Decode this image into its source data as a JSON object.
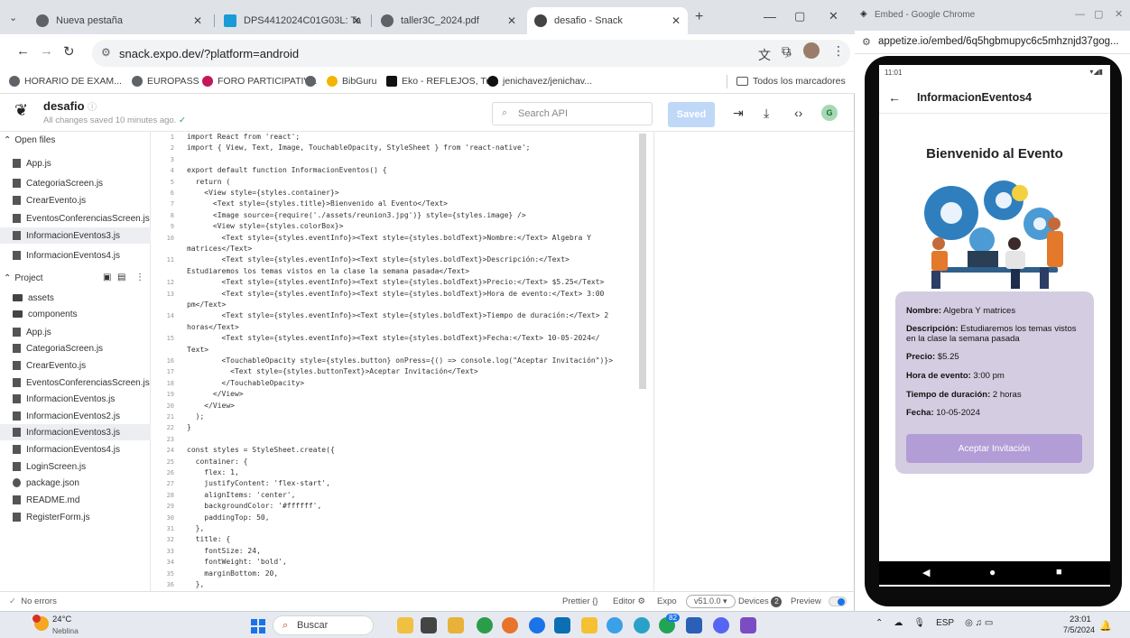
{
  "browser": {
    "tabs": [
      {
        "label": "Nueva pestaña"
      },
      {
        "label": "DPS4412024C01G03L: Taller"
      },
      {
        "label": "taller3C_2024.pdf"
      },
      {
        "label": "desafio - Snack"
      }
    ],
    "url": "snack.expo.dev/?platform=android",
    "bookmarks": [
      "HORARIO DE EXAM...",
      "EUROPASS",
      "FORO PARTICIPATIV...",
      "BibGuru",
      "Eko - REFLEJOS, Tu...",
      "jenichavez/jenichav..."
    ],
    "all_bookmarks": "Todos los marcadores"
  },
  "snack": {
    "project_name": "desafio",
    "status": "All changes saved 10 minutes ago.",
    "search_placeholder": "Search API",
    "saved_label": "Saved",
    "avatar_initial": "G",
    "open_files_label": "Open files",
    "open_files": [
      "App.js",
      "CategoriaScreen.js",
      "CrearEvento.js",
      "EventosConferenciasScreen.js",
      "InformacionEventos3.js",
      "InformacionEventos4.js"
    ],
    "project_label": "Project",
    "project_files": [
      "assets",
      "components",
      "App.js",
      "CategoriaScreen.js",
      "CrearEvento.js",
      "EventosConferenciasScreen.js",
      "InformacionEventos.js",
      "InformacionEventos2.js",
      "InformacionEventos3.js",
      "InformacionEventos4.js",
      "LoginScreen.js",
      "package.json",
      "README.md",
      "RegisterForm.js"
    ],
    "status_bar": {
      "errors": "No errors",
      "prettier": "Prettier",
      "editor": "Editor",
      "expo": "Expo",
      "version": "v51.0.0",
      "devices": "Devices",
      "devices_count": "2",
      "preview": "Preview"
    }
  },
  "code_lines": [
    "import React from 'react';",
    "import { View, Text, Image, TouchableOpacity, StyleSheet } from 'react-native';",
    "",
    "export default function InformacionEventos() {",
    "  return (",
    "    <View style={styles.container}>",
    "      <Text style={styles.title}>Bienvenido al Evento</Text>",
    "      <Image source={require('./assets/reunion3.jpg')} style={styles.image} />",
    "      <View style={styles.colorBox}>",
    "        <Text style={styles.eventInfo}><Text style={styles.boldText}>Nombre:</Text> Algebra Y",
    "matrices</Text>",
    "        <Text style={styles.eventInfo}><Text style={styles.boldText}>Descripción:</Text>",
    "Estudiaremos los temas vistos en la clase la semana pasada</Text>",
    "        <Text style={styles.eventInfo}><Text style={styles.boldText}>Precio:</Text> $5.25</Text>",
    "        <Text style={styles.eventInfo}><Text style={styles.boldText}>Hora de evento:</Text> 3:00",
    "pm</Text>",
    "        <Text style={styles.eventInfo}><Text style={styles.boldText}>Tiempo de duración:</Text> 2",
    "horas</Text>",
    "        <Text style={styles.eventInfo}><Text style={styles.boldText}>Fecha:</Text> 10-05-2024</",
    "Text>",
    "        <TouchableOpacity style={styles.button} onPress={() => console.log(\"Aceptar Invitación\")}>",
    "          <Text style={styles.buttonText}>Aceptar Invitación</Text>",
    "        </TouchableOpacity>",
    "      </View>",
    "    </View>",
    "  );",
    "}",
    "",
    "const styles = StyleSheet.create({",
    "  container: {",
    "    flex: 1,",
    "    justifyContent: 'flex-start',",
    "    alignItems: 'center',",
    "    backgroundColor: '#ffffff',",
    "    paddingTop: 50,",
    "  },",
    "  title: {",
    "    fontSize: 24,",
    "    fontWeight: 'bold',",
    "    marginBottom: 20,",
    "  },"
  ],
  "line_numbers": [
    "1",
    "2",
    "3",
    "4",
    "5",
    "6",
    "7",
    "8",
    "9",
    "10",
    "",
    "11",
    "",
    "12",
    "13",
    "",
    "14",
    "",
    "15",
    "",
    "16",
    "17",
    "18",
    "19",
    "20",
    "21",
    "22",
    "23",
    "24",
    "25",
    "26",
    "27",
    "28",
    "29",
    "30",
    "31",
    "32",
    "33",
    "34",
    "35",
    "36"
  ],
  "popup": {
    "title": "Embed - Google Chrome",
    "url": "appetize.io/embed/6q5hgbmupyc6c5mhznjd37gog..."
  },
  "phone": {
    "time": "11:01",
    "screen_title": "InformacionEventos4",
    "heading": "Bienvenido al Evento",
    "fields": [
      {
        "label": "Nombre:",
        "value": " Algebra Y matrices"
      },
      {
        "label": "Descripción:",
        "value": " Estudiaremos los temas vistos en la clase la semana pasada"
      },
      {
        "label": "Precio:",
        "value": " $5.25"
      },
      {
        "label": "Hora de evento:",
        "value": " 3:00 pm"
      },
      {
        "label": "Tiempo de duración:",
        "value": " 2 horas"
      },
      {
        "label": "Fecha:",
        "value": " 10-05-2024"
      }
    ],
    "button": "Aceptar Invitación"
  },
  "taskbar": {
    "temp": "24°C",
    "weather": "Neblina",
    "search": "Buscar",
    "lang": "ESP",
    "time": "23:01",
    "date": "7/5/2024",
    "badge_mail": "82"
  },
  "colors": {
    "accent": "#1a73e8",
    "event_box": "#d4cde1",
    "accept_button": "#b29dd6",
    "saved_button": "#c0d8f8"
  }
}
